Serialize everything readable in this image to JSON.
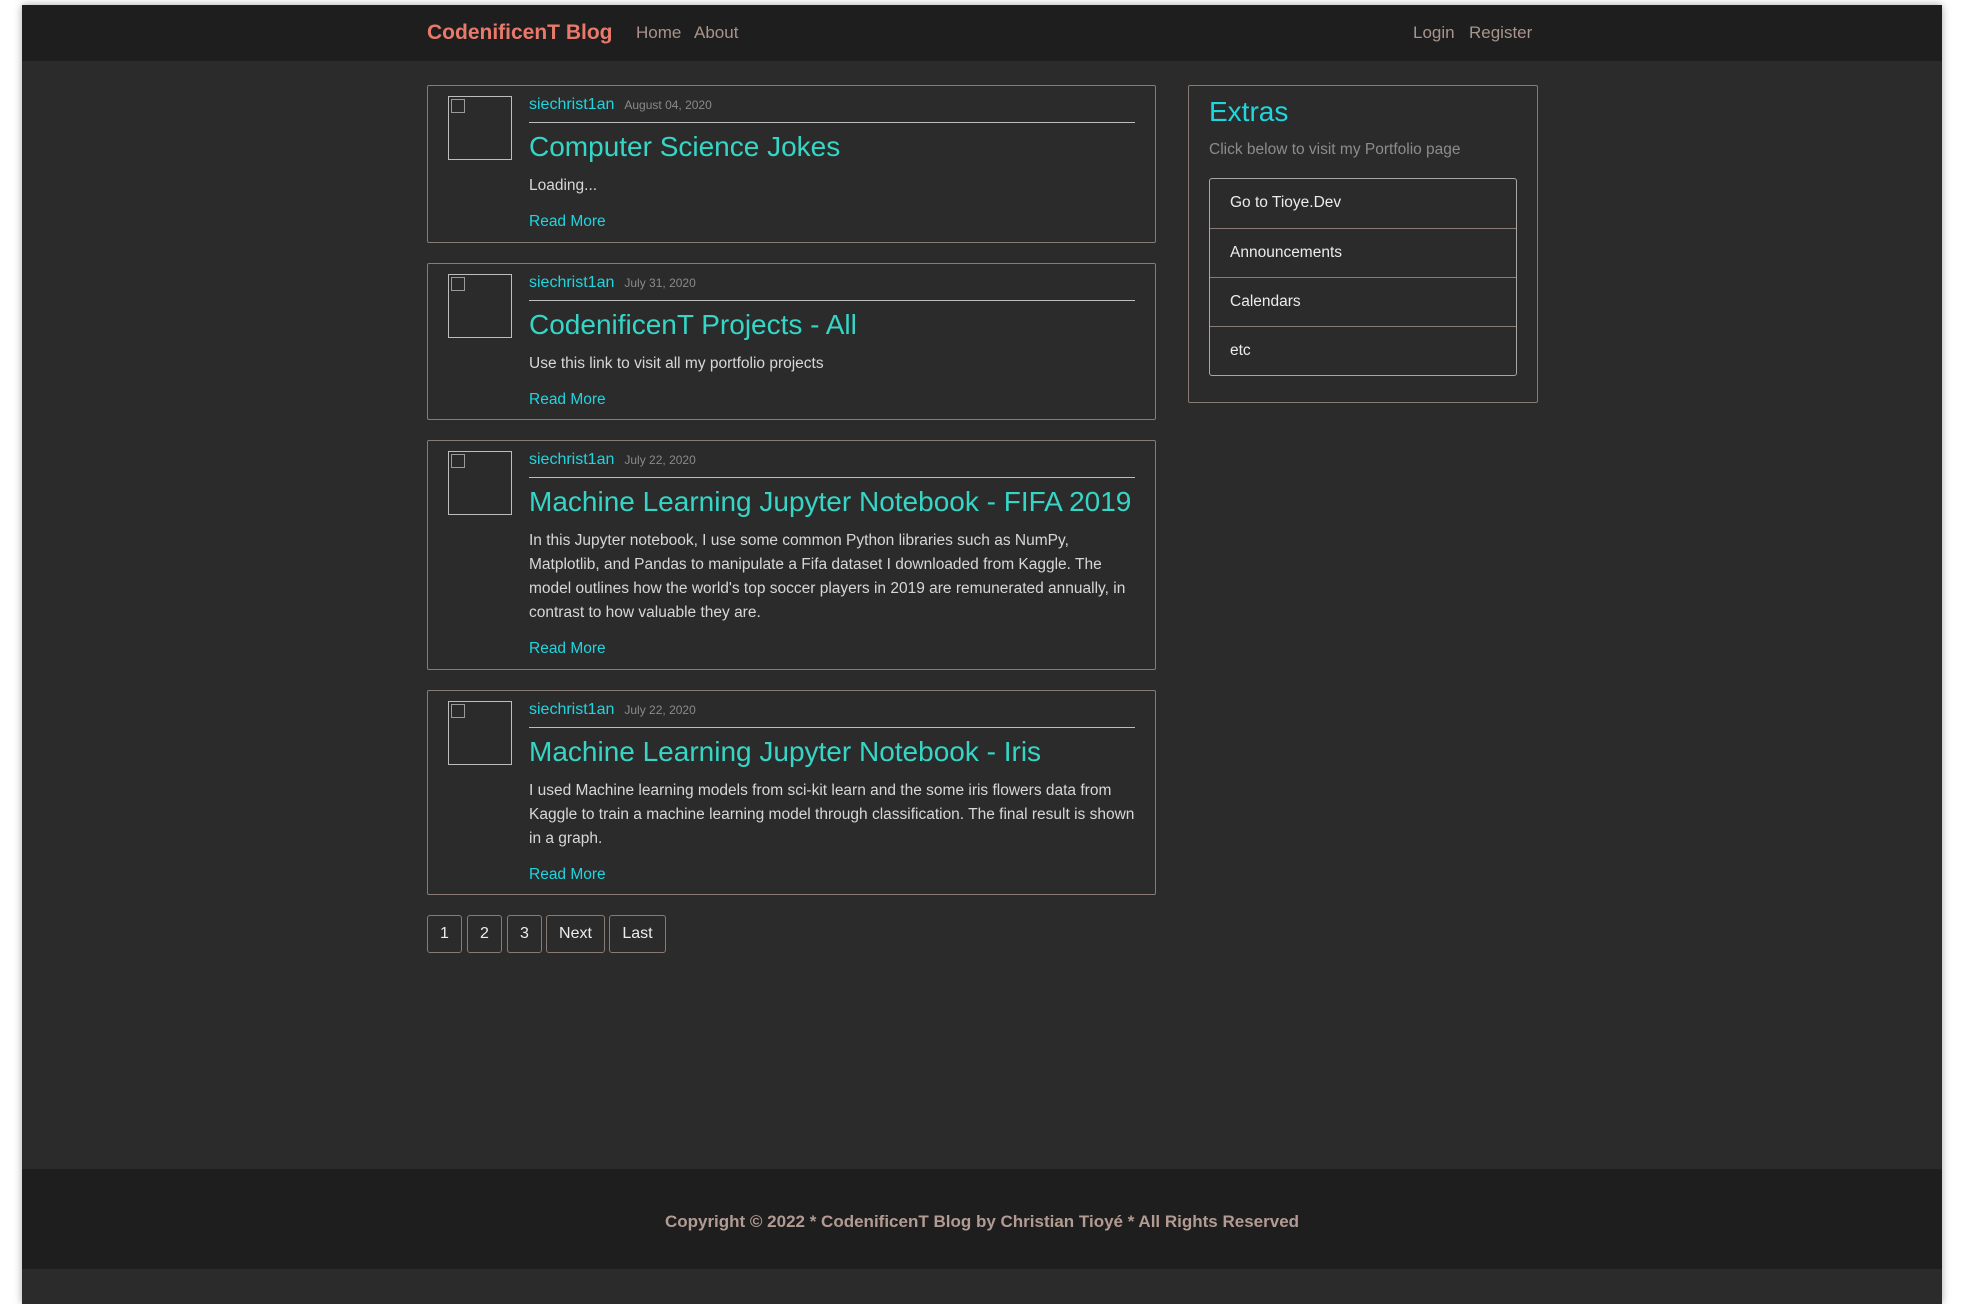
{
  "navbar": {
    "brand": "CodenificenT Blog",
    "left_links": [
      "Home",
      "About"
    ],
    "right_links": [
      "Login",
      "Register"
    ]
  },
  "posts": [
    {
      "author": "siechrist1an",
      "date": "August 04, 2020",
      "title": "Computer Science Jokes",
      "excerpt": "Loading...",
      "read_more": "Read More"
    },
    {
      "author": "siechrist1an",
      "date": "July 31, 2020",
      "title": "CodenificenT Projects - All",
      "excerpt": "Use this link to visit all my portfolio projects",
      "read_more": "Read More"
    },
    {
      "author": "siechrist1an",
      "date": "July 22, 2020",
      "title": "Machine Learning Jupyter Notebook - FIFA 2019",
      "excerpt": "In this Jupyter notebook, I use some common Python libraries such as NumPy, Matplotlib, and Pandas to manipulate a Fifa dataset I downloaded from Kaggle. The model outlines how the world's top soccer players in 2019 are remunerated annually, in contrast to how valuable they are.",
      "read_more": "Read More"
    },
    {
      "author": "siechrist1an",
      "date": "July 22, 2020",
      "title": "Machine Learning Jupyter Notebook - Iris",
      "excerpt": "I used Machine learning models from sci-kit learn and the some iris flowers data from Kaggle to train a machine learning model through classification. The final result is shown in a graph.",
      "read_more": "Read More"
    }
  ],
  "pagination": [
    "1",
    "2",
    "3",
    "Next",
    "Last"
  ],
  "sidebar": {
    "title": "Extras",
    "subtitle": "Click below to visit my Portfolio page",
    "items": [
      "Go to Tioye.Dev",
      "Announcements",
      "Calendars",
      "etc"
    ]
  },
  "footer": {
    "text": "Copyright © 2022 * CodenificenT Blog by Christian Tioyé * All Rights Reserved"
  },
  "colors": {
    "background": "#2b2b2b",
    "navbar": "#1e1e1e",
    "brand": "#e8796b",
    "accent_cyan": "#1fd6e0",
    "title_teal": "#35d6c6"
  }
}
